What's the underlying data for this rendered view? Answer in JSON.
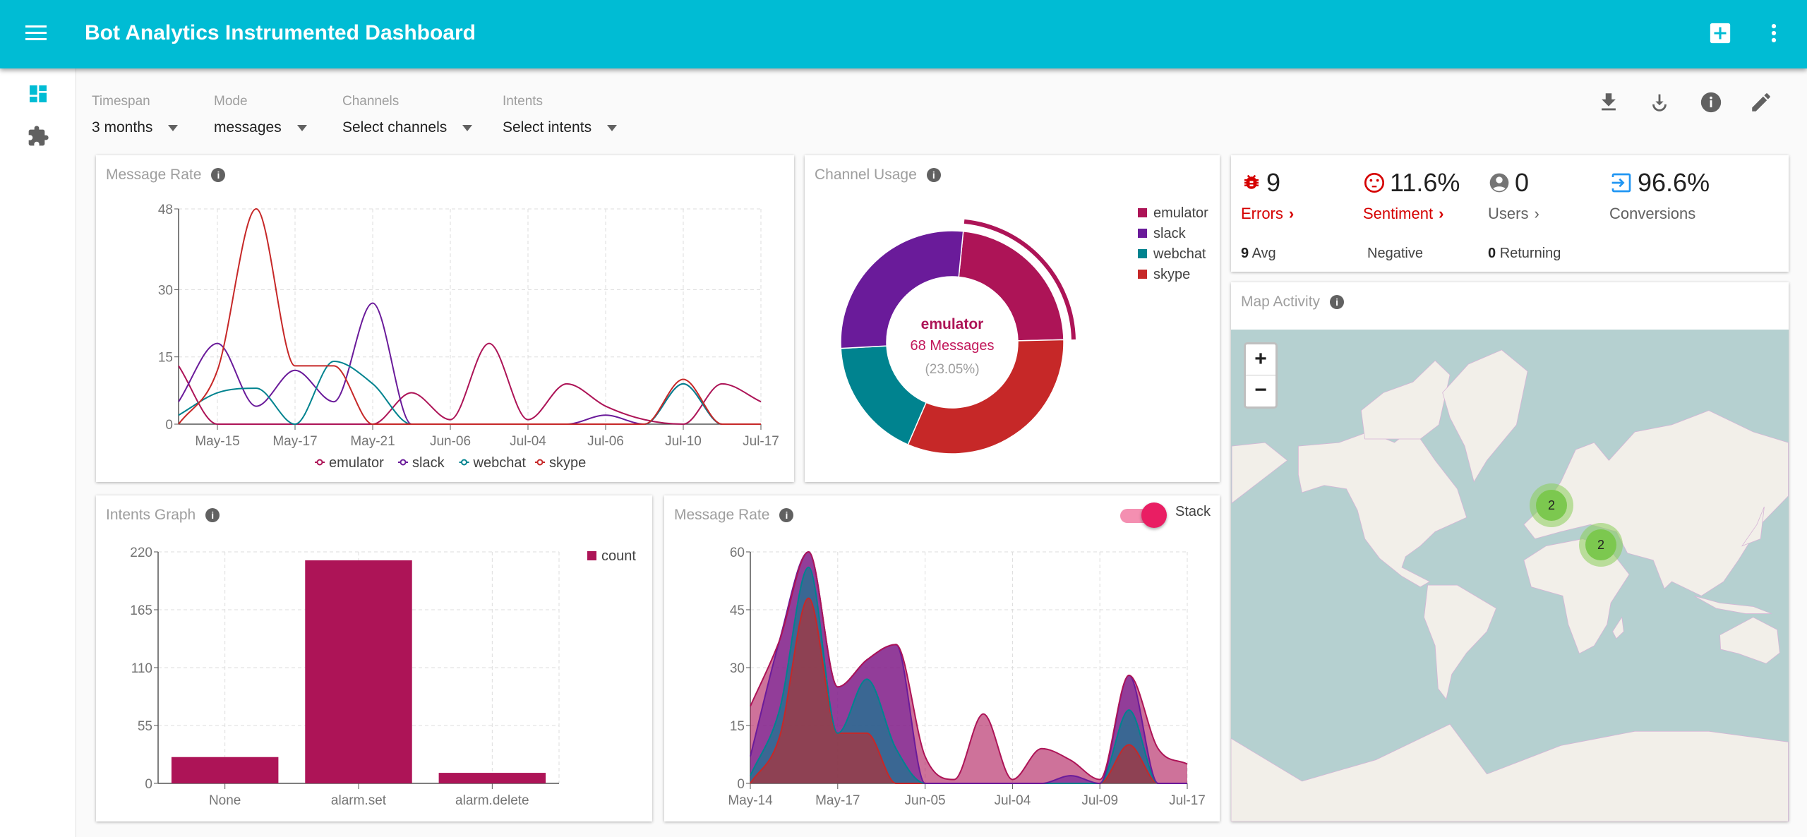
{
  "header": {
    "title": "Bot Analytics Instrumented Dashboard",
    "menu_icon": "menu-icon",
    "add_icon": "add-box-icon",
    "more_icon": "more-vert-icon",
    "color": "#00bcd4"
  },
  "rail": {
    "items": [
      {
        "icon": "dashboard-icon",
        "active": true
      },
      {
        "icon": "extension-icon",
        "active": false
      }
    ]
  },
  "filters": [
    {
      "label": "Timespan",
      "value": "3 months"
    },
    {
      "label": "Mode",
      "value": "messages"
    },
    {
      "label": "Channels",
      "value": "Select channels"
    },
    {
      "label": "Intents",
      "value": "Select intents"
    }
  ],
  "toolbar": {
    "icons": [
      "download-icon",
      "download-partial-icon",
      "info-icon",
      "edit-icon"
    ]
  },
  "colors": {
    "emulator": "#ad1457",
    "slack": "#6a1b9a",
    "webchat": "#00838f",
    "skype": "#c62828"
  },
  "kpis": {
    "errors": {
      "value": "9",
      "label": "Errors",
      "sub_value": "9",
      "sub_label": "Avg",
      "color": "#d50000"
    },
    "sentiment": {
      "value": "11.6%",
      "label": "Sentiment",
      "sub_label": "Negative",
      "color": "#d50000"
    },
    "users": {
      "value": "0",
      "label": "Users",
      "sub_value": "0",
      "sub_label": "Returning"
    },
    "conversions": {
      "value": "96.6%",
      "label": "Conversions",
      "color": "#2196f3"
    }
  },
  "map": {
    "title": "Map Activity",
    "zoom_in": "+",
    "zoom_out": "−",
    "clusters": [
      {
        "count": "2",
        "region": "Western Europe"
      },
      {
        "count": "2",
        "region": "Middle East"
      }
    ]
  },
  "cards": {
    "message_rate": {
      "title": "Message Rate"
    },
    "channel_usage": {
      "title": "Channel Usage",
      "center_name": "emulator",
      "center_count": "68 Messages",
      "center_pct": "(23.05%)"
    },
    "intents": {
      "title": "Intents Graph"
    },
    "message_rate_stacked": {
      "title": "Message Rate",
      "toggle_label": "Stack",
      "toggle_on": true
    }
  },
  "chart_data": [
    {
      "type": "line",
      "title": "Message Rate",
      "ylim": [
        0,
        48
      ],
      "yticks": [
        0,
        15,
        30,
        48
      ],
      "grid": true,
      "legend": "bottom",
      "categories": [
        "",
        "May-15",
        "",
        "May-17",
        "",
        "May-21",
        "",
        "Jun-06",
        "",
        "Jul-04",
        "",
        "Jul-06",
        "",
        "Jul-10",
        "",
        "Jul-17"
      ],
      "series": [
        {
          "name": "emulator",
          "values": [
            13,
            0,
            0,
            0,
            0,
            0,
            7,
            1,
            18,
            1,
            9,
            4,
            1,
            0,
            9,
            5
          ]
        },
        {
          "name": "slack",
          "values": [
            5,
            18,
            4,
            12,
            5,
            27,
            0,
            0,
            0,
            0,
            0,
            2,
            0,
            9,
            0,
            0
          ]
        },
        {
          "name": "webchat",
          "values": [
            2,
            7,
            8,
            0,
            14,
            9,
            0,
            0,
            0,
            0,
            0,
            0,
            0,
            9,
            0,
            0
          ]
        },
        {
          "name": "skype",
          "values": [
            0,
            12,
            48,
            13,
            13,
            0,
            0,
            0,
            0,
            0,
            0,
            0,
            0,
            10,
            0,
            0
          ]
        }
      ]
    },
    {
      "type": "pie",
      "title": "Channel Usage",
      "legend": "right",
      "donut": true,
      "categories": [
        "emulator",
        "slack",
        "webchat",
        "skype"
      ],
      "values": [
        68,
        81,
        52,
        94
      ],
      "highlighted": "emulator"
    },
    {
      "type": "bar",
      "title": "Intents Graph",
      "ylim": [
        0,
        220
      ],
      "yticks": [
        0,
        55,
        110,
        165,
        220
      ],
      "grid": true,
      "legend": "right",
      "categories": [
        "None",
        "alarm.set",
        "alarm.delete"
      ],
      "series": [
        {
          "name": "count",
          "values": [
            25,
            212,
            10
          ]
        }
      ]
    },
    {
      "type": "area",
      "stacked": true,
      "title": "Message Rate",
      "ylim": [
        0,
        60
      ],
      "yticks": [
        0,
        15,
        30,
        45,
        60
      ],
      "grid": true,
      "categories": [
        "May-14",
        "",
        "",
        "May-17",
        "",
        "",
        "Jun-05",
        "",
        "",
        "Jul-04",
        "",
        "",
        "Jul-09",
        "",
        "",
        "Jul-17"
      ],
      "series": [
        {
          "name": "skype",
          "values": [
            0,
            12,
            48,
            13,
            13,
            0,
            0,
            0,
            0,
            0,
            0,
            0,
            0,
            10,
            0,
            0
          ]
        },
        {
          "name": "webchat",
          "values": [
            2,
            7,
            8,
            0,
            14,
            9,
            0,
            0,
            0,
            0,
            0,
            0,
            0,
            9,
            0,
            0
          ]
        },
        {
          "name": "slack",
          "values": [
            5,
            18,
            4,
            12,
            5,
            27,
            0,
            0,
            0,
            0,
            0,
            2,
            0,
            9,
            0,
            0
          ]
        },
        {
          "name": "emulator",
          "values": [
            13,
            0,
            0,
            0,
            0,
            0,
            7,
            1,
            18,
            1,
            9,
            4,
            1,
            0,
            9,
            5
          ]
        }
      ]
    }
  ]
}
